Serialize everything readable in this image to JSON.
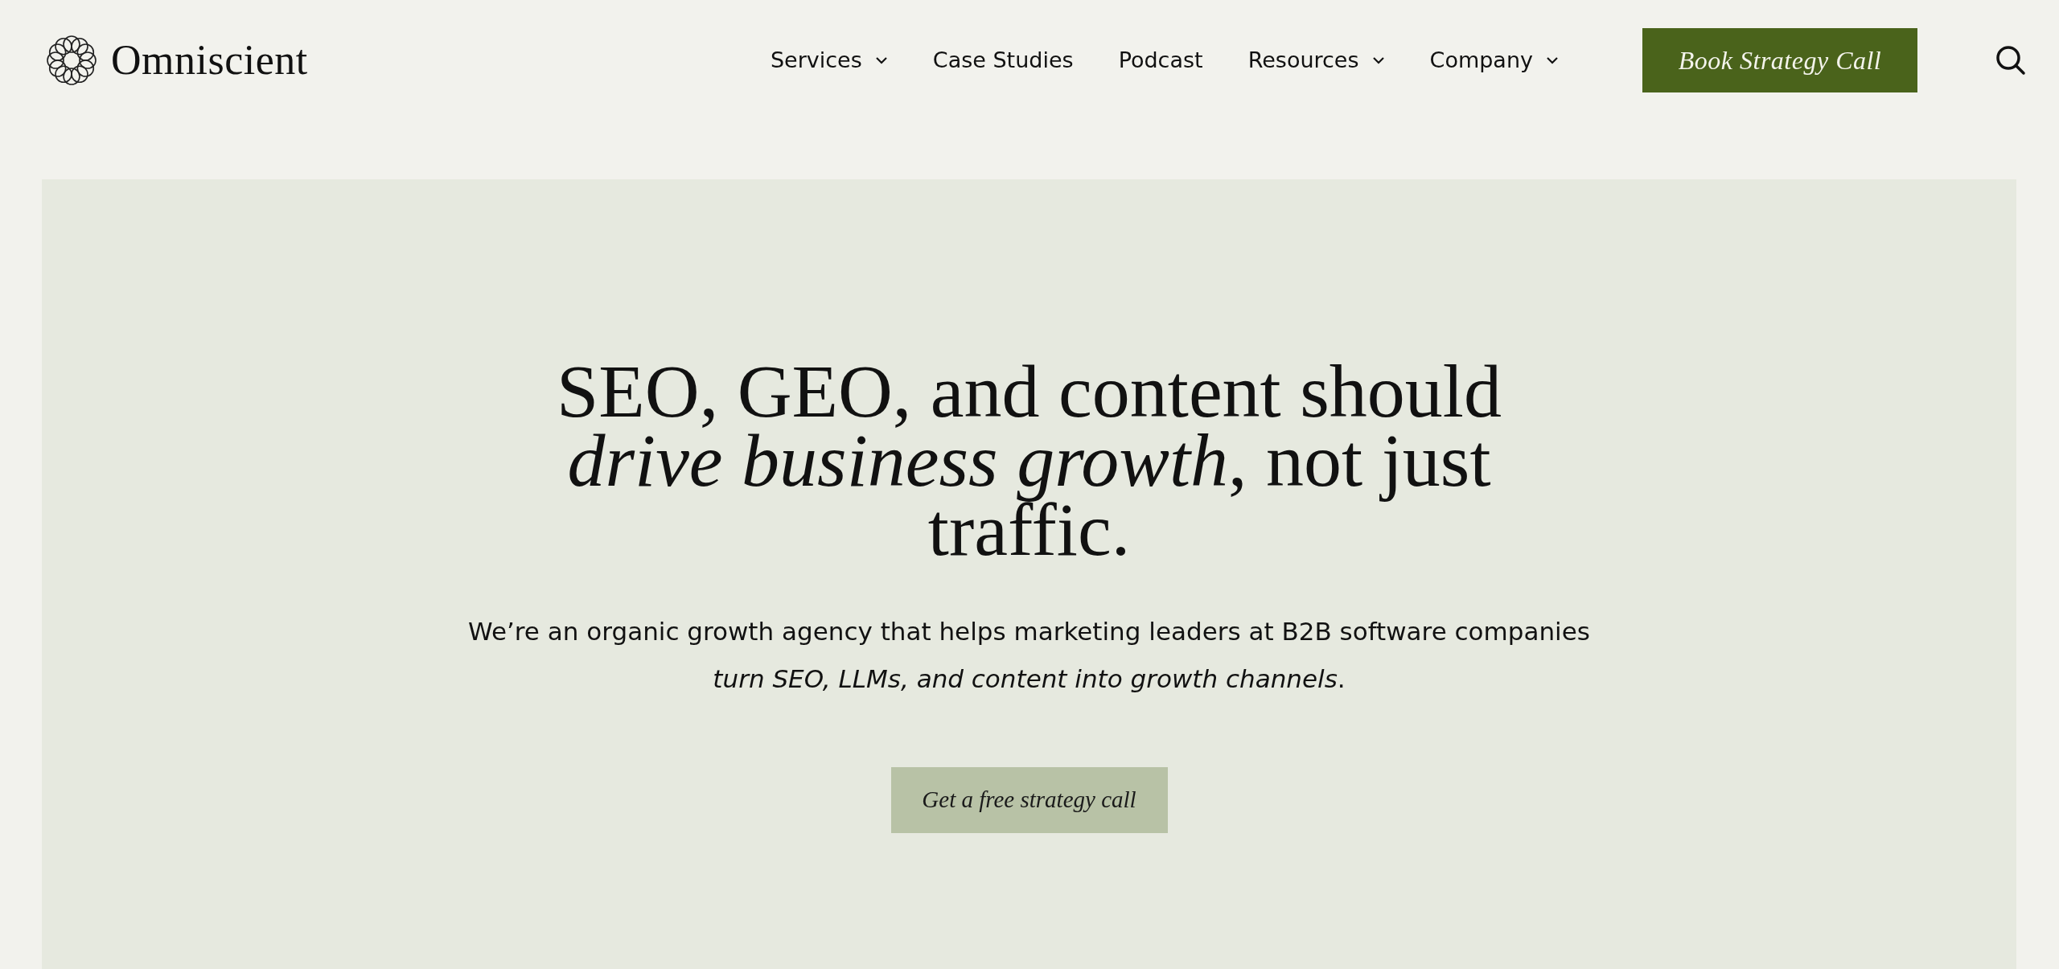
{
  "header": {
    "logo": "Omniscient",
    "nav": [
      {
        "label": "Services",
        "has_dropdown": true
      },
      {
        "label": "Case Studies",
        "has_dropdown": false
      },
      {
        "label": "Podcast",
        "has_dropdown": false
      },
      {
        "label": "Resources",
        "has_dropdown": true
      },
      {
        "label": "Company",
        "has_dropdown": true
      }
    ],
    "cta": "Book Strategy Call"
  },
  "hero": {
    "headline": "SEO, GEO, and content should *drive business growth*, not just traffic.",
    "subtext": "We’re an organic growth agency that helps marketing leaders at B2B software companies *turn SEO, LLMs, and content into growth channels*.",
    "button": "Get a free strategy call"
  }
}
